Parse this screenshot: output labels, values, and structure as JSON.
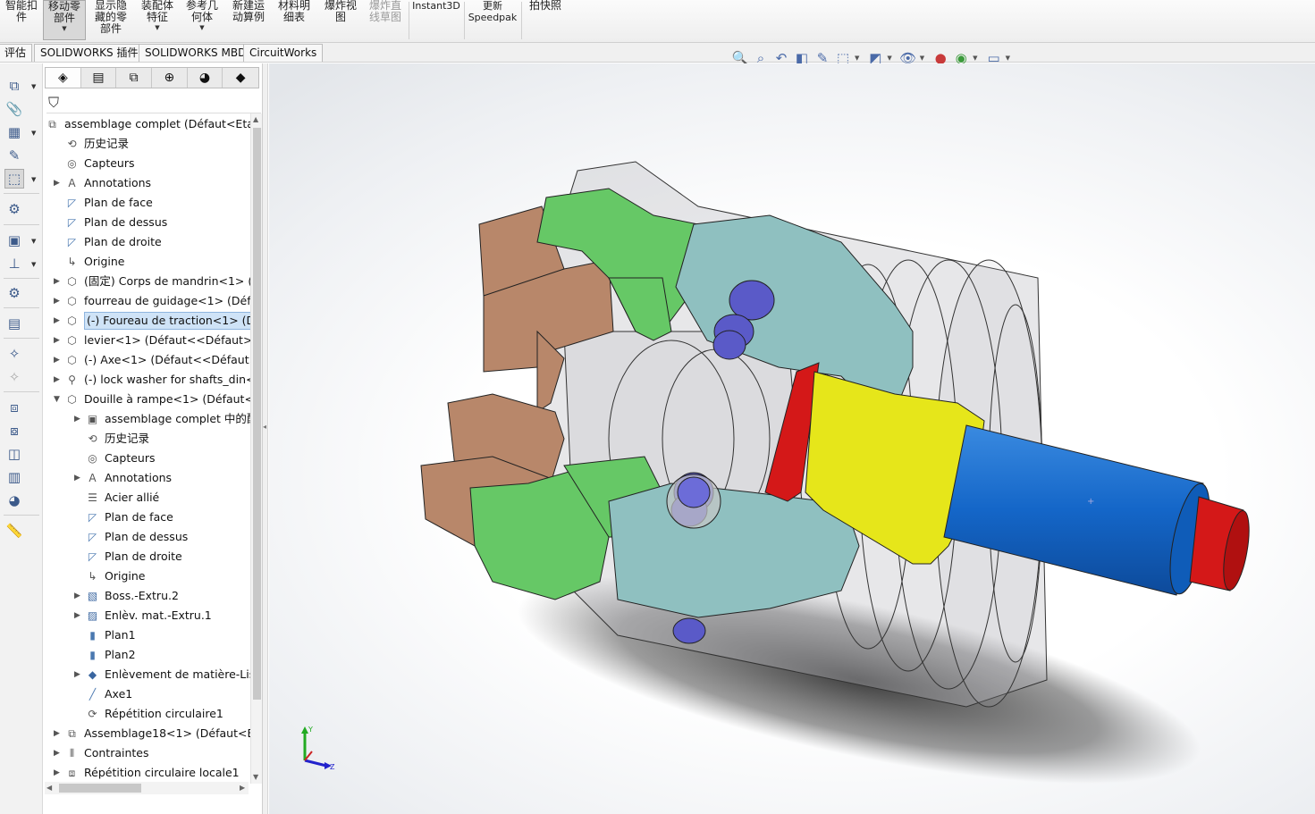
{
  "ribbon": {
    "buttons": [
      {
        "label": "智能扣\n件"
      },
      {
        "label": "移动零\n部件",
        "selected": true
      },
      {
        "label": "显示隐\n藏的零\n部件"
      },
      {
        "label": "装配体\n特征"
      },
      {
        "label": "参考几\n何体"
      },
      {
        "label": "新建运\n动算例"
      },
      {
        "label": "材料明\n细表"
      },
      {
        "label": "爆炸视\n图"
      },
      {
        "label": "爆炸直\n线草图"
      },
      {
        "label": "Instant3D"
      },
      {
        "label": "更新\nSpeedpak"
      },
      {
        "label": "拍快照"
      }
    ]
  },
  "tabs": [
    "评估",
    "SOLIDWORKS 插件",
    "SOLIDWORKS MBD",
    "CircuitWorks"
  ],
  "hud_icons": [
    "zoom-to-fit-icon",
    "zoom-area-icon",
    "previous-view-icon",
    "section-view-icon",
    "dynamic-annotation-icon",
    "view-orientation-icon",
    "display-style-icon",
    "hide-show-icon",
    "edit-appearance-icon",
    "apply-scene-icon",
    "view-settings-icon"
  ],
  "feature_tabs": [
    "featuremanager-icon",
    "propertymanager-icon",
    "configurationmanager-icon",
    "dimxpert-icon",
    "displaymanager-icon",
    "cam-icon"
  ],
  "tree": [
    {
      "label": "assemblage complet  (Défaut<Etat",
      "icon": "assembly-icon",
      "level": 0,
      "exp": "",
      "selected": false
    },
    {
      "label": "历史记录",
      "icon": "history-icon",
      "level": 1,
      "exp": "",
      "selected": false
    },
    {
      "label": "Capteurs",
      "icon": "sensors-icon",
      "level": 1,
      "exp": "",
      "selected": false
    },
    {
      "label": "Annotations",
      "icon": "annotations-icon",
      "level": 1,
      "exp": "▶",
      "selected": false
    },
    {
      "label": "Plan de face",
      "icon": "plane-icon",
      "level": 1,
      "exp": "",
      "selected": false
    },
    {
      "label": "Plan de dessus",
      "icon": "plane-icon",
      "level": 1,
      "exp": "",
      "selected": false
    },
    {
      "label": "Plan de droite",
      "icon": "plane-icon",
      "level": 1,
      "exp": "",
      "selected": false
    },
    {
      "label": "Origine",
      "icon": "origin-icon",
      "level": 1,
      "exp": "",
      "selected": false
    },
    {
      "label": "(固定) Corps de mandrin<1> (D",
      "icon": "part-icon",
      "level": 1,
      "exp": "▶",
      "selected": false
    },
    {
      "label": "fourreau de guidage<1> (Défa",
      "icon": "part-icon",
      "level": 1,
      "exp": "▶",
      "selected": false
    },
    {
      "label": "(-) Foureau de traction<1> (Dé",
      "icon": "part-icon",
      "level": 1,
      "exp": "▶",
      "selected": true
    },
    {
      "label": "levier<1> (Défaut<<Défaut>_Et",
      "icon": "part-icon",
      "level": 1,
      "exp": "▶",
      "selected": false
    },
    {
      "label": "(-) Axe<1> (Défaut<<Défaut>_E",
      "icon": "part-icon",
      "level": 1,
      "exp": "▶",
      "selected": false
    },
    {
      "label": "(-) lock washer for shafts_din<1",
      "icon": "fastener-icon",
      "level": 1,
      "exp": "▶",
      "selected": false
    },
    {
      "label": "Douille à rampe<1> (Défaut<<",
      "icon": "part-icon",
      "level": 1,
      "exp": "▼",
      "selected": false
    },
    {
      "label": "assemblage complet 中的配",
      "icon": "mates-folder-icon",
      "level": 2,
      "exp": "▶",
      "selected": false
    },
    {
      "label": "历史记录",
      "icon": "history-icon",
      "level": 2,
      "exp": "",
      "selected": false
    },
    {
      "label": "Capteurs",
      "icon": "sensors-icon",
      "level": 2,
      "exp": "",
      "selected": false
    },
    {
      "label": "Annotations",
      "icon": "annotations-icon",
      "level": 2,
      "exp": "▶",
      "selected": false
    },
    {
      "label": "Acier allié",
      "icon": "material-icon",
      "level": 2,
      "exp": "",
      "selected": false
    },
    {
      "label": "Plan de face",
      "icon": "plane-icon",
      "level": 2,
      "exp": "",
      "selected": false
    },
    {
      "label": "Plan de dessus",
      "icon": "plane-icon",
      "level": 2,
      "exp": "",
      "selected": false
    },
    {
      "label": "Plan de droite",
      "icon": "plane-icon",
      "level": 2,
      "exp": "",
      "selected": false
    },
    {
      "label": "Origine",
      "icon": "origin-icon",
      "level": 2,
      "exp": "",
      "selected": false
    },
    {
      "label": "Boss.-Extru.2",
      "icon": "boss-extrude-icon",
      "level": 2,
      "exp": "▶",
      "selected": false
    },
    {
      "label": "Enlèv. mat.-Extru.1",
      "icon": "cut-extrude-icon",
      "level": 2,
      "exp": "▶",
      "selected": false
    },
    {
      "label": "Plan1",
      "icon": "plane-feature-icon",
      "level": 2,
      "exp": "",
      "selected": false
    },
    {
      "label": "Plan2",
      "icon": "plane-feature-icon",
      "level": 2,
      "exp": "",
      "selected": false
    },
    {
      "label": "Enlèvement de matière-Liss",
      "icon": "cut-loft-icon",
      "level": 2,
      "exp": "▶",
      "selected": false
    },
    {
      "label": "Axe1",
      "icon": "axis-icon",
      "level": 2,
      "exp": "",
      "selected": false
    },
    {
      "label": "Répétition circulaire1",
      "icon": "circular-pattern-icon",
      "level": 2,
      "exp": "",
      "selected": false
    },
    {
      "label": "Assemblage18<1> (Défaut<Eta",
      "icon": "subassembly-icon",
      "level": 1,
      "exp": "▶",
      "selected": false
    },
    {
      "label": "Contraintes",
      "icon": "mates-icon",
      "level": 1,
      "exp": "▶",
      "selected": false
    },
    {
      "label": "Répétition circulaire locale1",
      "icon": "local-pattern-icon",
      "level": 1,
      "exp": "▶",
      "selected": false
    }
  ],
  "colors": {
    "accent_selection": "#cfe3f7",
    "bronze_jaw": "#b8876a",
    "green_part": "#66c866",
    "lever": "#8fc0c0",
    "yellow_sleeve": "#e6e61a",
    "blue_shaft": "#1466c8",
    "red_tip": "#d41818",
    "pin": "#5a5ac8"
  }
}
